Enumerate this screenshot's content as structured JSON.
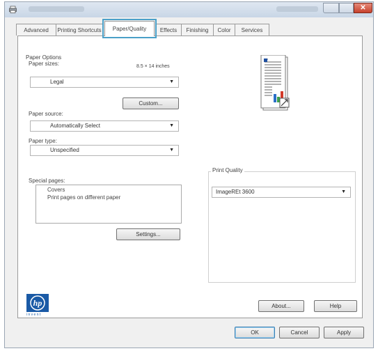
{
  "tabs": [
    {
      "label": "Advanced"
    },
    {
      "label": "Printing Shortcuts"
    },
    {
      "label": "Paper/Quality"
    },
    {
      "label": "Effects"
    },
    {
      "label": "Finishing"
    },
    {
      "label": "Color"
    },
    {
      "label": "Services"
    }
  ],
  "paper_options": {
    "group_label": "Paper Options",
    "size_label": "Paper sizes:",
    "size_dimensions": "8.5 × 14 inches",
    "size_value": "Legal",
    "custom_button": "Custom...",
    "source_label": "Paper source:",
    "source_value": "Automatically Select",
    "type_label": "Paper type:",
    "type_value": "Unspecified"
  },
  "special_pages": {
    "label": "Special pages:",
    "items": [
      "Covers",
      "Print pages on different paper"
    ],
    "settings_button": "Settings..."
  },
  "print_quality": {
    "label": "Print Quality",
    "value": "ImageREt 3600"
  },
  "footer": {
    "about_button": "About...",
    "help_button": "Help",
    "ok_button": "OK",
    "cancel_button": "Cancel",
    "apply_button": "Apply",
    "hp_tagline": "i n v e n t"
  },
  "colors": {
    "active_tab_outline": "#4aa0c8",
    "hp_logo": "#1a5aa6",
    "close_button": "#c7412c"
  }
}
